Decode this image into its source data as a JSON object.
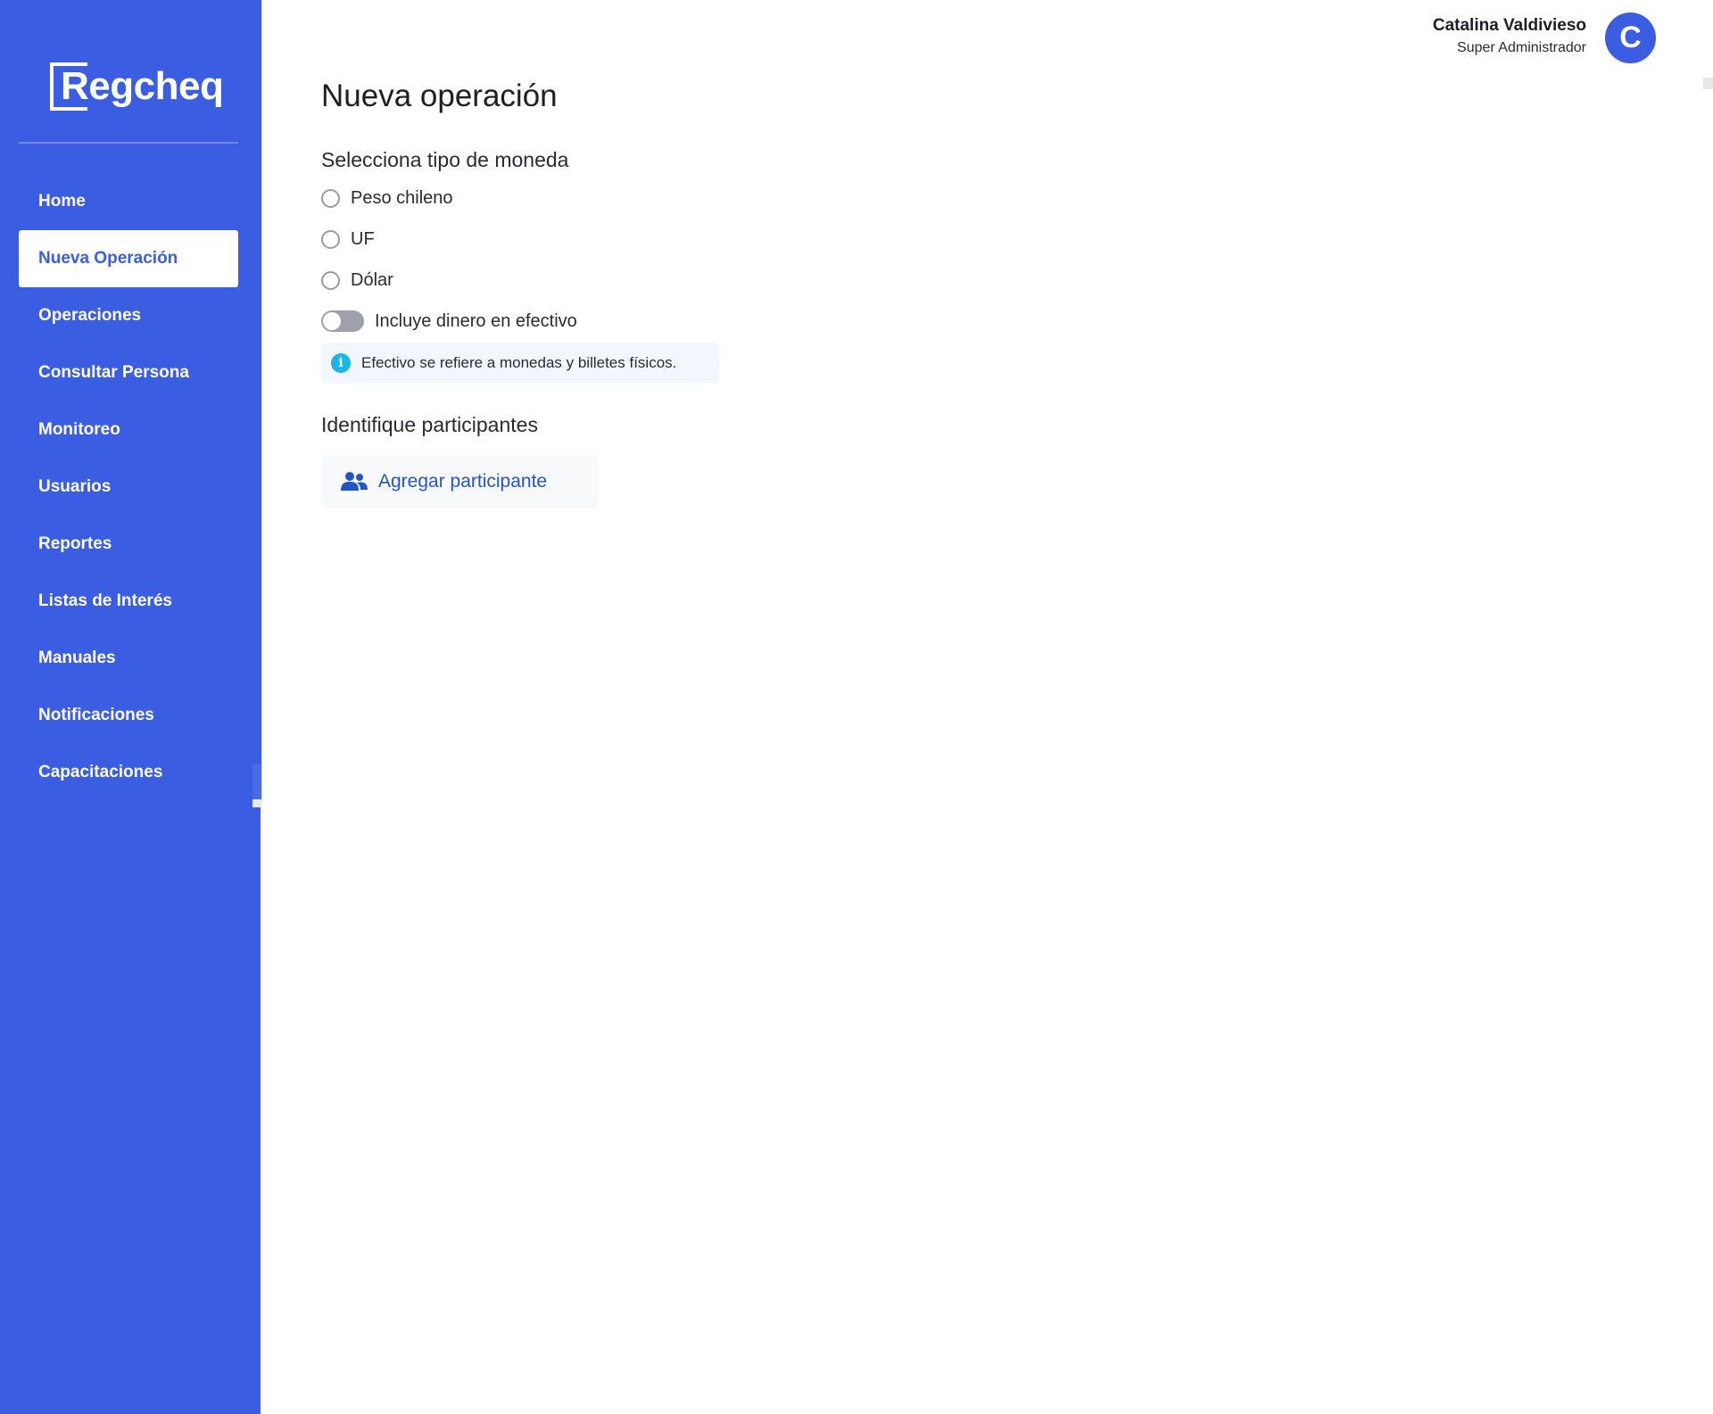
{
  "brand": {
    "logo_text": "Regcheq",
    "accent_color": "#3b5de2"
  },
  "sidebar": {
    "items": [
      {
        "label": "Home",
        "active": false
      },
      {
        "label": "Nueva Operación",
        "active": true
      },
      {
        "label": "Operaciones",
        "active": false
      },
      {
        "label": "Consultar Persona",
        "active": false
      },
      {
        "label": "Monitoreo",
        "active": false
      },
      {
        "label": "Usuarios",
        "active": false
      },
      {
        "label": "Reportes",
        "active": false
      },
      {
        "label": "Listas de Interés",
        "active": false
      },
      {
        "label": "Manuales",
        "active": false
      },
      {
        "label": "Notificaciones",
        "active": false
      },
      {
        "label": "Capacitaciones",
        "active": false
      }
    ]
  },
  "header": {
    "user_name": "Catalina Valdivieso",
    "user_role": "Super Administrador",
    "avatar_initial": "C"
  },
  "main": {
    "page_title": "Nueva operación",
    "currency_section": {
      "title": "Selecciona tipo de moneda",
      "options": [
        "Peso chileno",
        "UF",
        "Dólar"
      ],
      "selected": null
    },
    "cash_toggle": {
      "label": "Incluye dinero en efectivo",
      "checked": false
    },
    "info_note": {
      "icon": "info-icon",
      "text": "Efectivo se refiere a monedas y billetes físicos."
    },
    "participants_section": {
      "title": "Identifique participantes",
      "add_button_label": "Agregar participante",
      "add_button_icon": "users-icon"
    }
  }
}
